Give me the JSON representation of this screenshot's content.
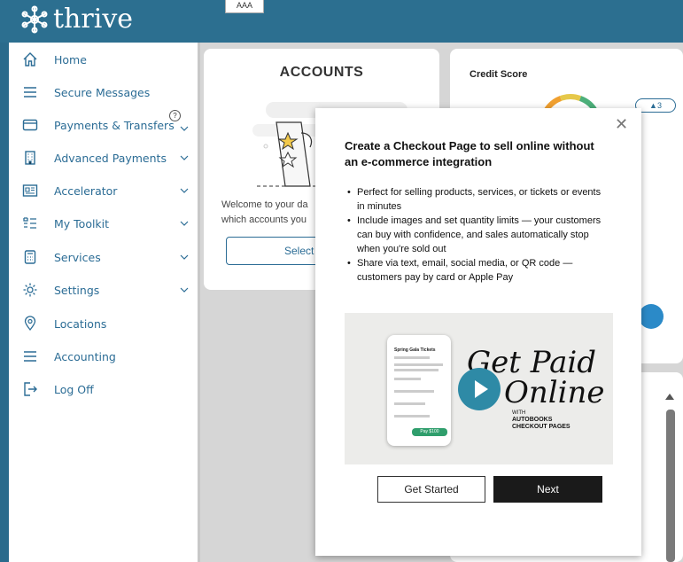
{
  "header": {
    "logo_text": "thrive",
    "top_box_text": "AAA"
  },
  "sidebar": {
    "items": [
      {
        "label": "Home",
        "icon": "home-icon"
      },
      {
        "label": "Secure Messages",
        "icon": "menu-lines-icon"
      },
      {
        "label": "Payments & Transfers",
        "icon": "card-icon"
      },
      {
        "label": "Advanced Payments",
        "icon": "building-icon"
      },
      {
        "label": "Accelerator",
        "icon": "newspaper-icon"
      },
      {
        "label": "My Toolkit",
        "icon": "list-icon"
      },
      {
        "label": "Services",
        "icon": "calculator-icon"
      },
      {
        "label": "Settings",
        "icon": "gear-icon"
      },
      {
        "label": "Locations",
        "icon": "location-pin-icon"
      },
      {
        "label": "Accounting",
        "icon": "menu-lines-icon"
      },
      {
        "label": "Log Off",
        "icon": "logout-icon"
      }
    ],
    "help_label": "?"
  },
  "accounts": {
    "title": "ACCOUNTS",
    "text_line1": "Welcome to your da",
    "text_line2": "which accounts you",
    "button_label": "Select"
  },
  "credit": {
    "title": "Credit Score",
    "badge": "3"
  },
  "modal": {
    "title": "Create a Checkout Page to sell online without an e-commerce integration",
    "bullets": [
      "Perfect for selling products, services, or tickets or events in minutes",
      "Include images and set quantity limits — your customers can buy with confidence, and sales automatically stop when you're sold out",
      "Share via text, email, social media, or QR code — customers pay by card or Apple Pay"
    ],
    "video": {
      "script_line1": "Get Paid",
      "script_line2": "Online",
      "small_with": "WITH",
      "sub_line1": "AUTOBOOKS",
      "sub_line2": "CHECKOUT PAGES",
      "phone_heading": "Spring Gala Tickets",
      "phone_button": "Pay $100"
    },
    "get_started_label": "Get Started",
    "next_label": "Next",
    "close_symbol": "✕"
  },
  "colors": {
    "brand": "#2c6f90",
    "link": "#2b6c95",
    "next_button": "#1a1a1a",
    "play_button": "#2e8aa6"
  }
}
